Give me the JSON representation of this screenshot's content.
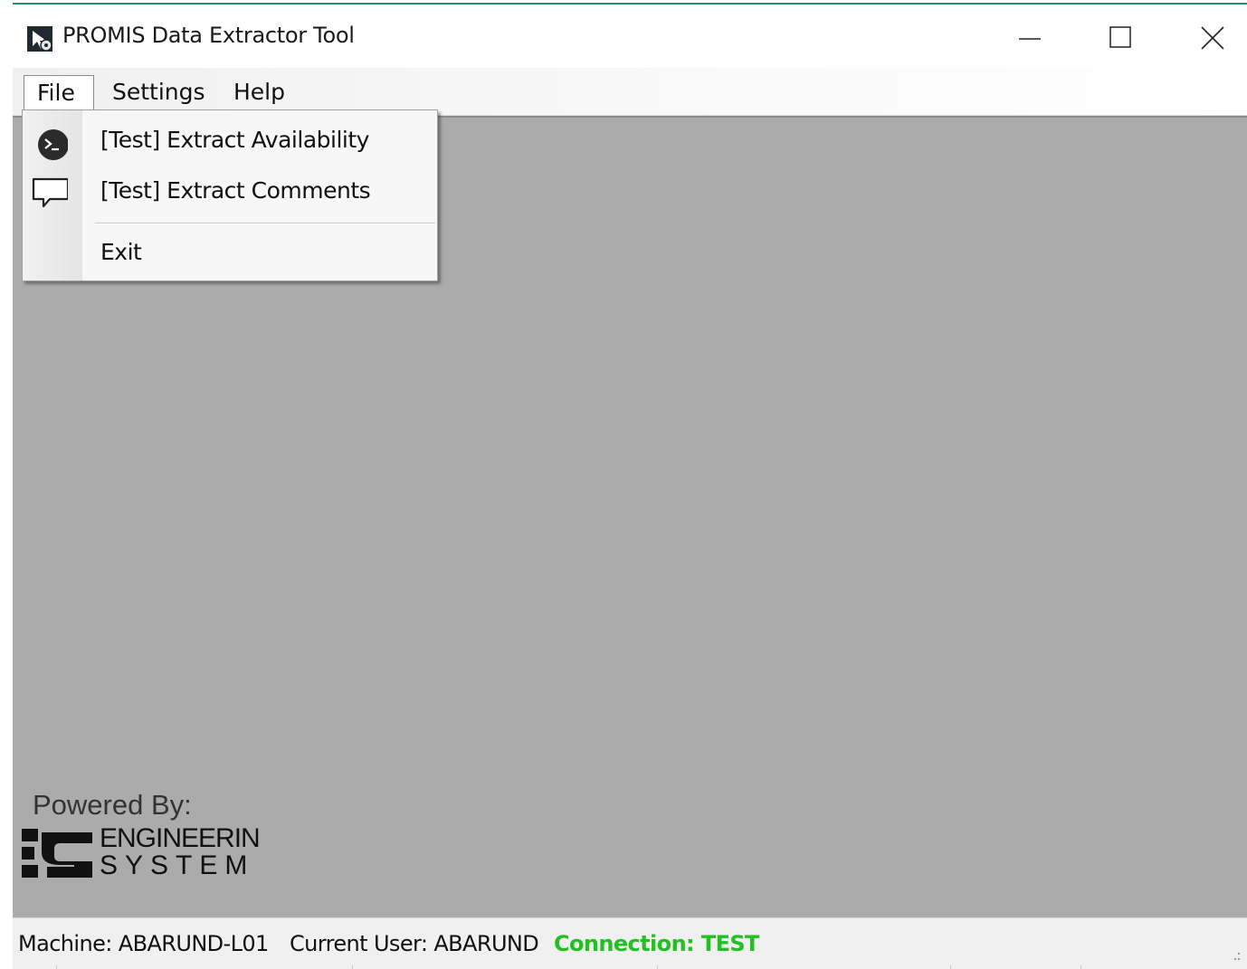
{
  "window": {
    "title": "PROMIS Data Extractor Tool",
    "accent_color": "#1f8f6f",
    "controls": {
      "minimize_icon": "minimize-icon",
      "maximize_icon": "maximize-icon",
      "close_icon": "close-icon"
    }
  },
  "menubar": {
    "items": [
      {
        "label": "File",
        "open": true
      },
      {
        "label": "Settings"
      },
      {
        "label": "Help"
      }
    ]
  },
  "file_menu": {
    "items": [
      {
        "label": "[Test] Extract Availability",
        "icon": "terminal-icon"
      },
      {
        "label": "[Test] Extract Comments",
        "icon": "speech-bubble-icon"
      },
      {
        "label": "Exit"
      }
    ]
  },
  "client": {
    "background_color": "#ababab",
    "powered_by": "Powered By:",
    "logo_line1": "ENGINEERIN",
    "logo_line2": "SYSTEM"
  },
  "statusbar": {
    "machine": "Machine: ABARUND-L01",
    "user": "Current User: ABARUND",
    "connection": "Connection: TEST",
    "connection_color": "#22c022"
  }
}
